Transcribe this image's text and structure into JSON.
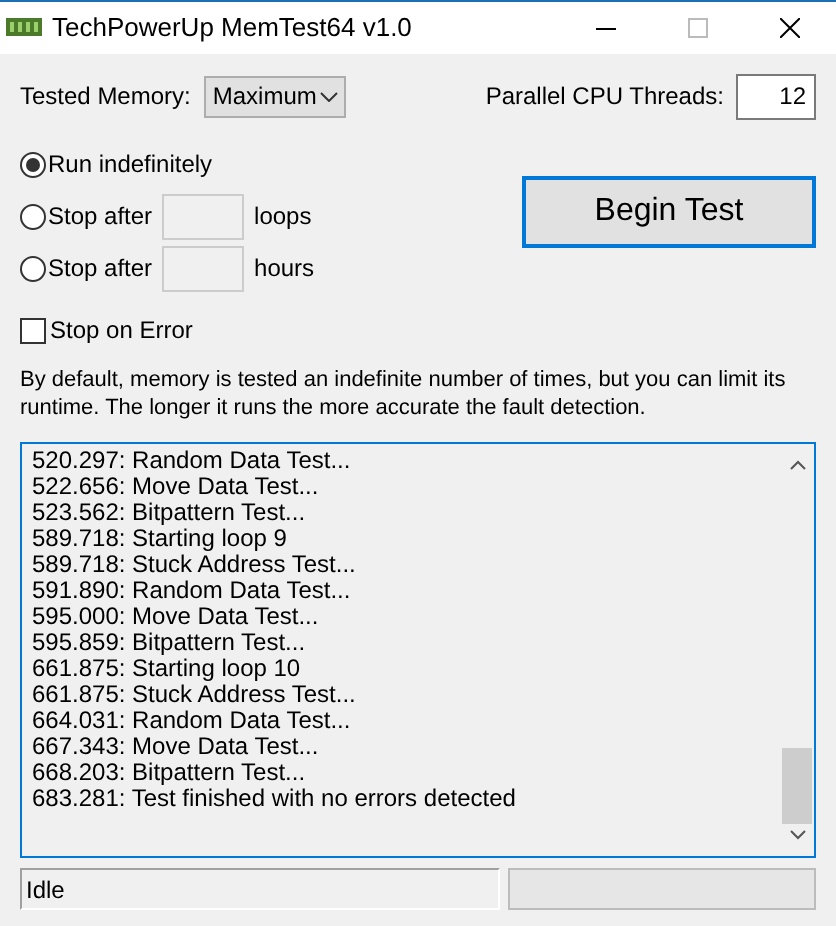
{
  "window": {
    "title": "TechPowerUp MemTest64 v1.0"
  },
  "tested_memory": {
    "label": "Tested Memory:",
    "value": "Maximum"
  },
  "threads": {
    "label": "Parallel CPU Threads:",
    "value": "12"
  },
  "run_modes": [
    {
      "label": "Run indefinitely",
      "selected": true,
      "kind": "plain"
    },
    {
      "label": "Stop after",
      "unit": "loops",
      "selected": false,
      "kind": "input"
    },
    {
      "label": "Stop after",
      "unit": "hours",
      "selected": false,
      "kind": "input"
    }
  ],
  "begin_button": {
    "label": "Begin Test"
  },
  "stop_on_error": {
    "label": "Stop on Error",
    "checked": false
  },
  "description": "By default, memory is tested an indefinite number of times, but you can limit its runtime. The longer it runs the more accurate the fault detection.",
  "log": [
    "520.297: Random Data Test...",
    "522.656: Move Data Test...",
    "523.562: Bitpattern Test...",
    "589.718: Starting loop 9",
    "589.718: Stuck Address Test...",
    "591.890: Random Data Test...",
    "595.000: Move Data Test...",
    "595.859: Bitpattern Test...",
    "661.875: Starting loop 10",
    "661.875: Stuck Address Test...",
    "664.031: Random Data Test...",
    "667.343: Move Data Test...",
    "668.203: Bitpattern Test...",
    "683.281: Test finished with no errors detected"
  ],
  "status_bar": {
    "status": "Idle",
    "progress": {
      "level": 0
    }
  }
}
